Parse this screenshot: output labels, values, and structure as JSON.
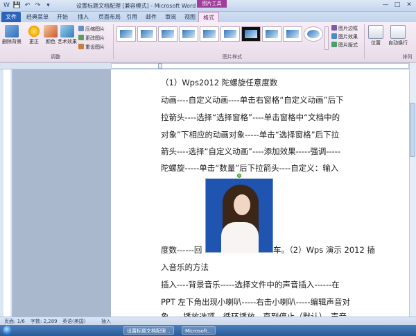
{
  "window": {
    "title": "设置标题文档配理 [兼容模式] - Microsoft Word",
    "context_tab_group": "图片工具",
    "controls": [
      "—",
      "□",
      "✕"
    ]
  },
  "quick_access": [
    "W",
    "💾",
    "↶",
    "↷",
    "▾"
  ],
  "tabs": [
    "文件",
    "经典菜单",
    "开始",
    "插入",
    "页面布局",
    "引用",
    "邮件",
    "审阅",
    "视图",
    "格式"
  ],
  "ribbon": {
    "adjust": {
      "remove_bg": "删除背景",
      "corrections": "更正",
      "color": "颜色",
      "artistic": "艺术效果",
      "compress": "压缩图片",
      "change": "更改图片",
      "reset": "重设图片",
      "label": "调整"
    },
    "picture_styles": {
      "label": "图片样式",
      "border": "图片边框",
      "effects": "图片效果",
      "layout": "图片版式"
    },
    "arrange": {
      "position": "位置",
      "wrap": "自动换行",
      "label": "排列"
    }
  },
  "document": {
    "lines": [
      "（1）Wps2012 陀螺旋任意度数",
      "动画----自定义动画----单击右窗格“自定义动画”后下",
      "拉箭头----选择“选择窗格”----单击窗格中“文档中的",
      "对象”下相应的动画对象-----单击“选择窗格”后下拉",
      "箭头----选择“自定义动画”----添加效果-----强调-----",
      "陀螺旋-----单击“数量”后下拉箭头----自定义：输入",
      "度数------回",
      "车。（2）Wps 演示 2012 插",
      "入音乐的方法",
      "插入----背景音乐-----选择文件中的声音插入------在",
      "PPT  左下角出现小喇叭-----右击小喇叭-----编辑声音对",
      "象-----播放选项，循环播放，直到停止（默认），声音"
    ]
  },
  "status": {
    "page": "页面: 1/6",
    "words": "字数: 2,289",
    "lang": "英语(美国)",
    "mode": "插入"
  },
  "taskbar": {
    "tasks": [
      "设置标题文档配理...",
      "Microsoft..."
    ]
  },
  "colors": {
    "file_tab": "#2a63b7",
    "format_tab": "#a13d9a",
    "photo_bg": "#1f55b0"
  }
}
